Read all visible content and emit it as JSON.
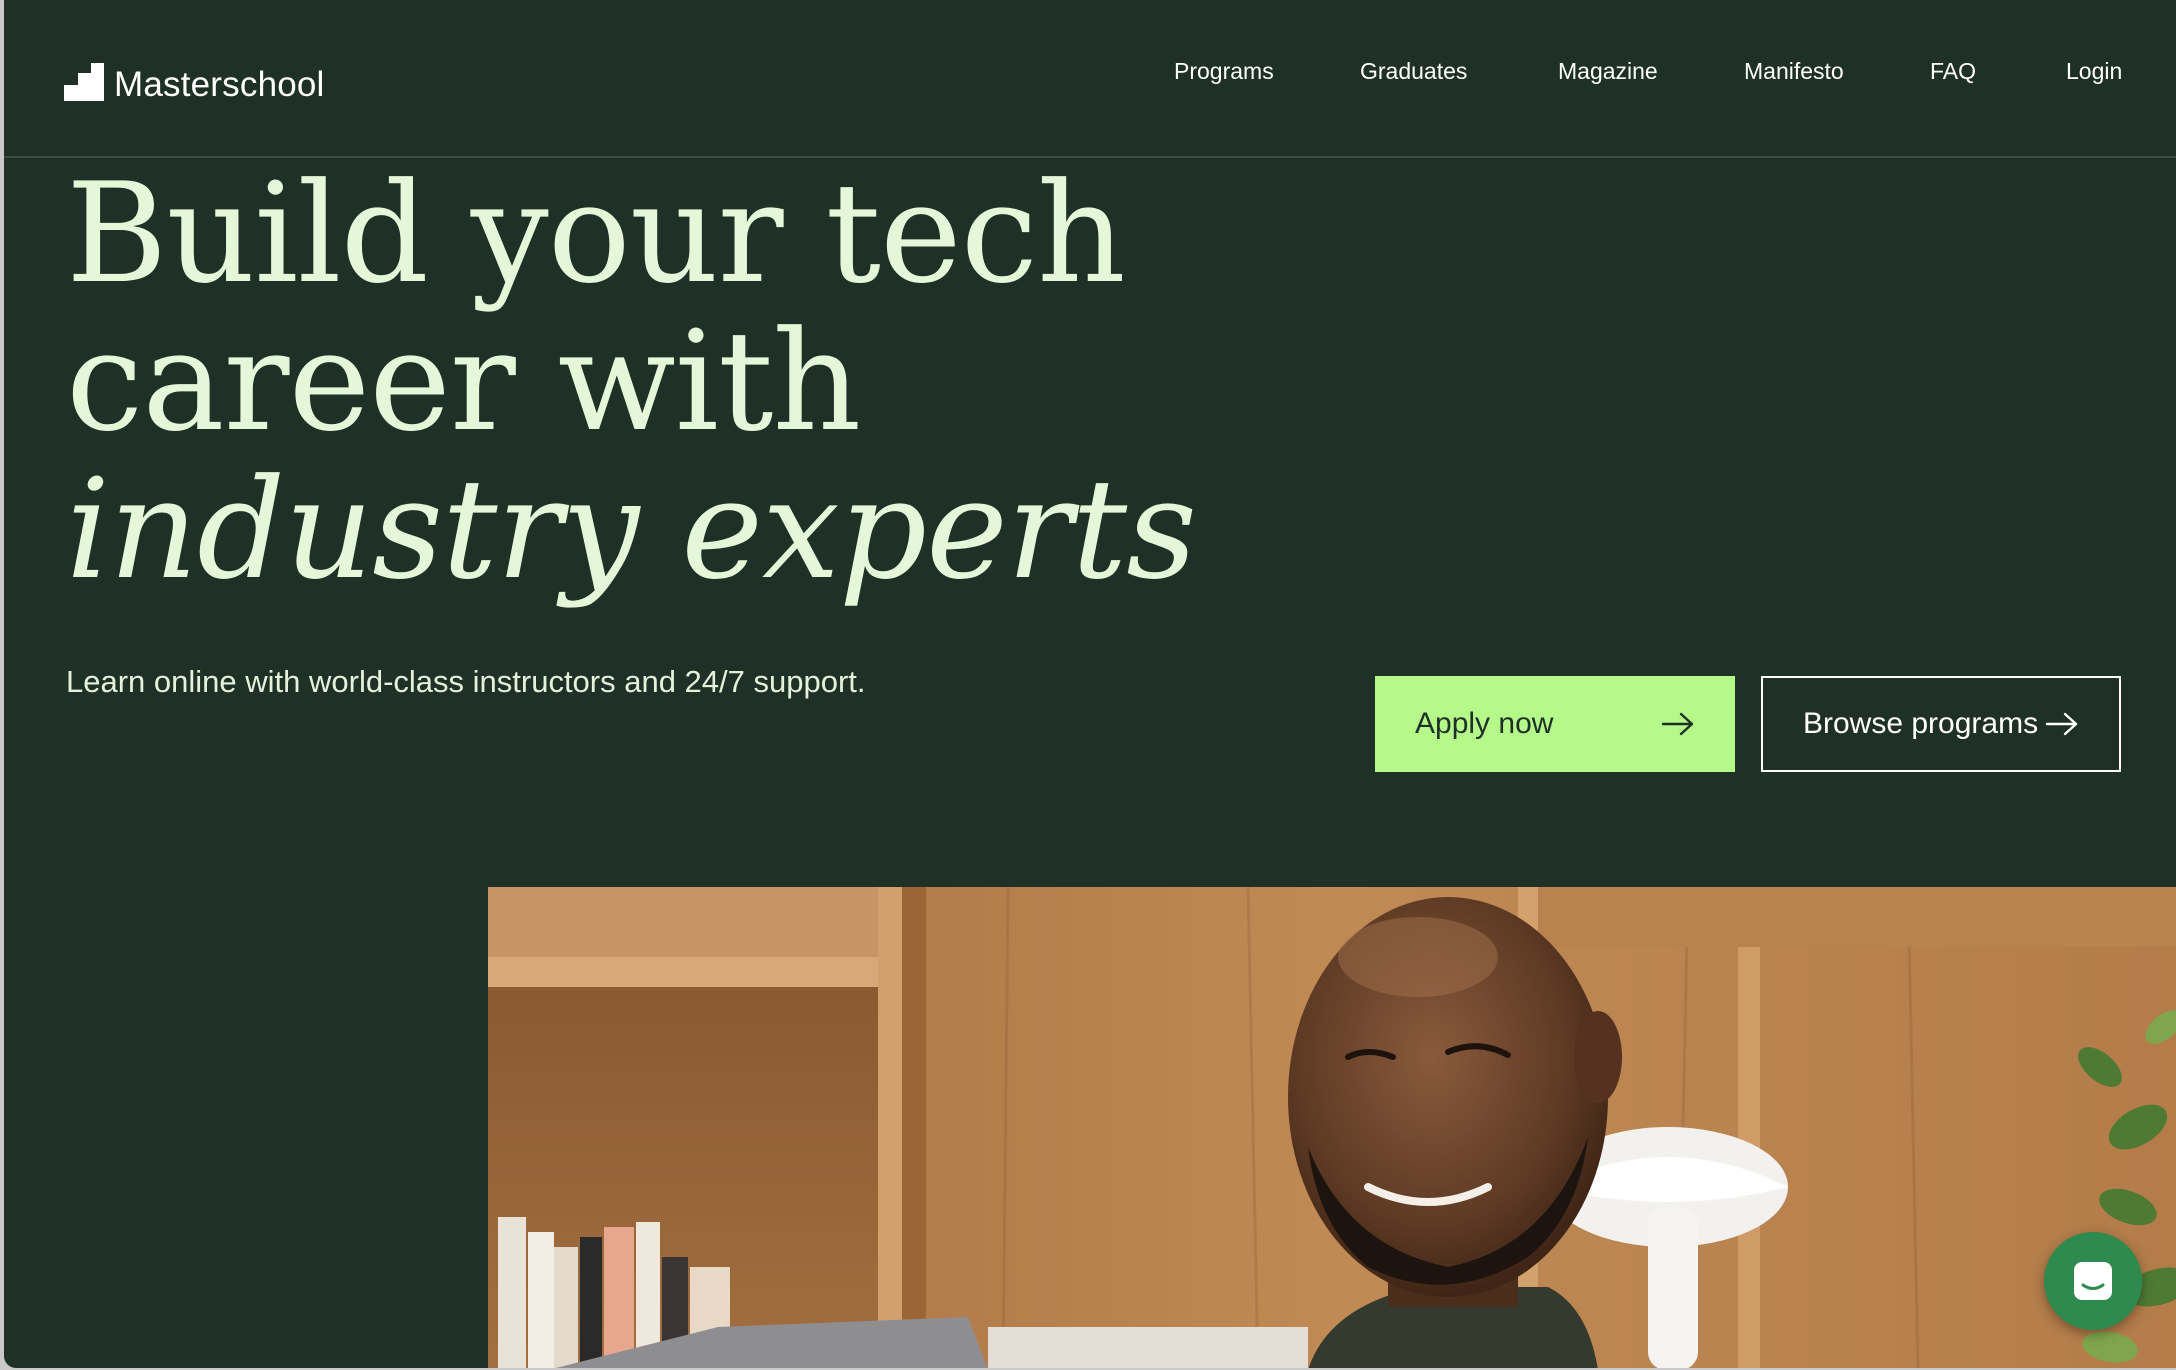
{
  "brand": {
    "name": "Masterschool"
  },
  "nav": {
    "items": [
      {
        "label": "Programs"
      },
      {
        "label": "Graduates"
      },
      {
        "label": "Magazine"
      },
      {
        "label": "Manifesto"
      },
      {
        "label": "FAQ"
      },
      {
        "label": "Login"
      }
    ]
  },
  "hero": {
    "title_line1": "Build your tech",
    "title_line2": "career with",
    "title_line3": "industry experts",
    "subtitle": "Learn online with world-class instructors and 24/7 support."
  },
  "actions": {
    "apply_label": "Apply now",
    "browse_label": "Browse programs"
  },
  "colors": {
    "background": "#1f3127",
    "accent": "#b5f98a",
    "headline": "#e4f8d9",
    "chat": "#2e8a4e"
  },
  "icons": {
    "logo": "masterschool-logo-icon",
    "arrow": "arrow-right-icon",
    "chat": "chat-icon"
  }
}
